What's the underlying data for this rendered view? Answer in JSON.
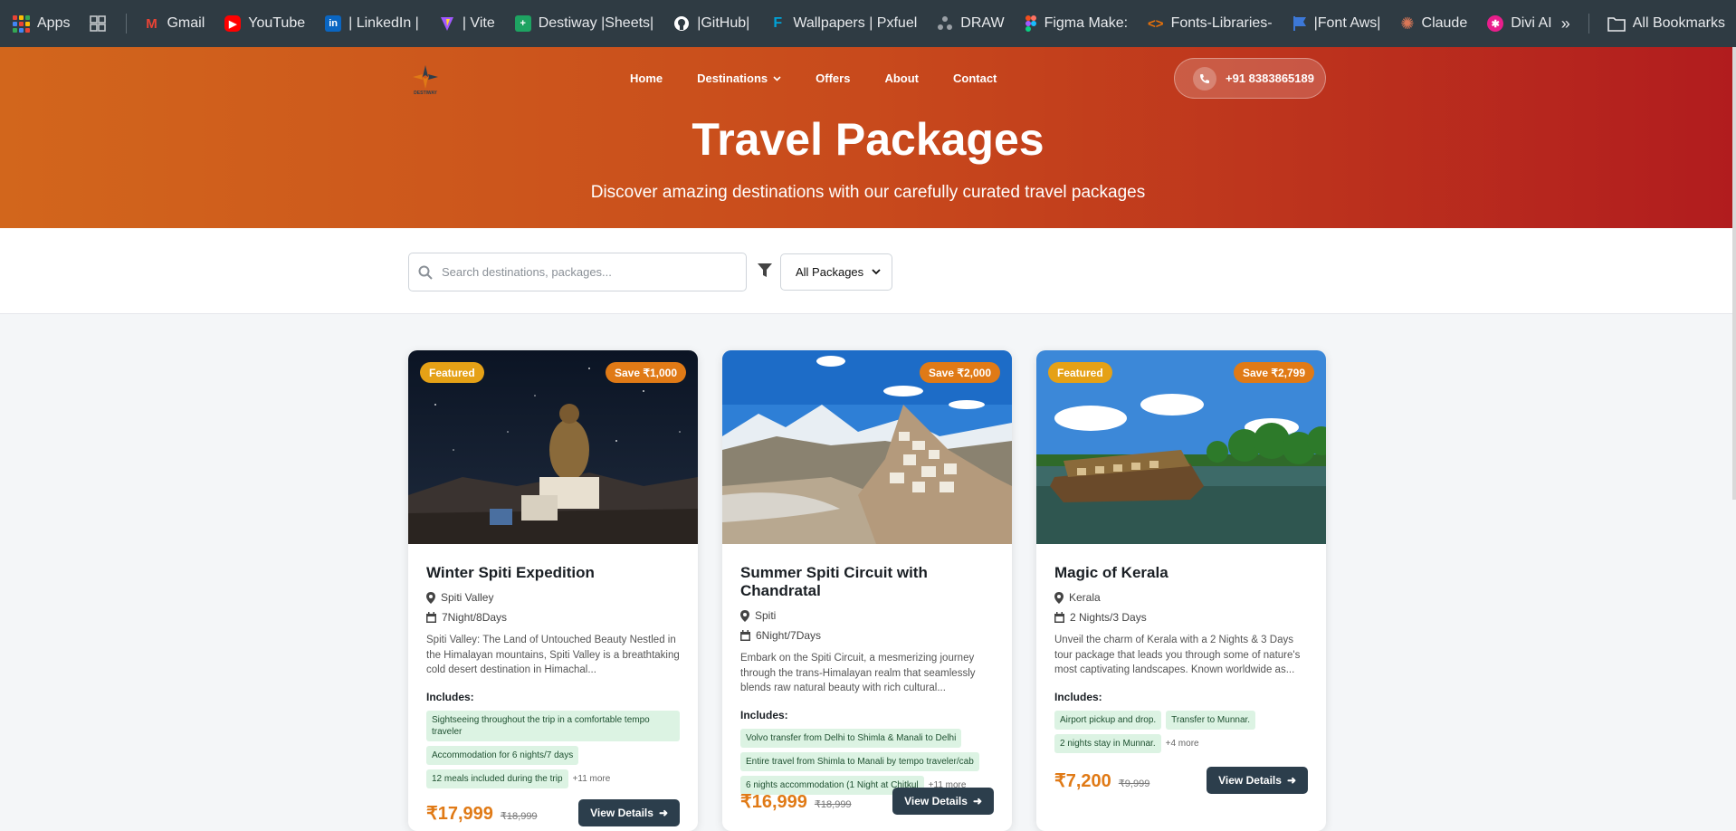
{
  "bookmarks": {
    "apps_label": "Apps",
    "items": [
      {
        "label": "Gmail",
        "icon": "gmail-icon",
        "color": "#ea4335"
      },
      {
        "label": "YouTube",
        "icon": "youtube-icon",
        "color": "#ff0000"
      },
      {
        "label": "| LinkedIn |",
        "icon": "linkedin-icon",
        "color": "#0a66c2"
      },
      {
        "label": "| Vite",
        "icon": "vite-icon",
        "color": "#a259ff"
      },
      {
        "label": "Destiway |Sheets|",
        "icon": "sheets-icon",
        "color": "#1ea362"
      },
      {
        "label": "|GitHub|",
        "icon": "github-icon",
        "color": "#ffffff"
      },
      {
        "label": "Wallpapers | Pxfuel",
        "icon": "pxfuel-icon",
        "color": "#00a2d8"
      },
      {
        "label": "DRAW",
        "icon": "draw-icon",
        "color": "#9aa0a6"
      },
      {
        "label": "Figma Make:",
        "icon": "figma-icon",
        "color": "#f24e1e"
      },
      {
        "label": "Fonts-Libraries-",
        "icon": "code-icon",
        "color": "#e8710a"
      },
      {
        "label": "|Font Aws|",
        "icon": "flag-icon",
        "color": "#3c78d8"
      },
      {
        "label": "Claude",
        "icon": "claude-icon",
        "color": "#d97757"
      },
      {
        "label": "Divi AI",
        "icon": "divi-icon",
        "color": "#e91e8c"
      }
    ],
    "all_bookmarks_label": "All Bookmarks"
  },
  "header": {
    "logo_alt": "DESTIWAY",
    "nav": {
      "home": "Home",
      "destinations": "Destinations",
      "offers": "Offers",
      "about": "About",
      "contact": "Contact"
    },
    "phone": "+91 8383865189",
    "colors": {
      "gradient_start": "#d2661c",
      "gradient_end": "#b11c1e"
    }
  },
  "hero": {
    "title": "Travel Packages",
    "subtitle": "Discover amazing destinations with our carefully curated travel packages"
  },
  "search": {
    "placeholder": "Search destinations, packages...",
    "filter_value": "All Packages"
  },
  "packages": [
    {
      "featured": "Featured",
      "save": "Save ₹1,000",
      "title": "Winter Spiti Expedition",
      "location": "Spiti Valley",
      "duration": "7Night/8Days",
      "description": "Spiti Valley: The Land of Untouched Beauty Nestled in the Himalayan mountains, Spiti Valley is a breathtaking cold desert destination in Himachal...",
      "includes_label": "Includes:",
      "includes": [
        "Sightseeing throughout the trip in a comfortable tempo traveler",
        "Accommodation for 6 nights/7 days",
        "12 meals included during the trip"
      ],
      "more": "+11 more",
      "price": "₹17,999",
      "old_price": "₹18,999",
      "cta": "View Details"
    },
    {
      "featured": "",
      "save": "Save ₹2,000",
      "title": "Summer Spiti Circuit with Chandratal",
      "location": "Spiti",
      "duration": "6Night/7Days",
      "description": "Embark on the Spiti Circuit, a mesmerizing journey through the trans-Himalayan realm that seamlessly blends raw natural beauty with rich cultural...",
      "includes_label": "Includes:",
      "includes": [
        "Volvo transfer from Delhi to Shimla & Manali to Delhi",
        "Entire travel from Shimla to Manali by tempo traveler/cab",
        "6 nights accommodation (1 Night at Chitkul"
      ],
      "more": "+11 more",
      "price": "₹16,999",
      "old_price": "₹18,999",
      "cta": "View Details"
    },
    {
      "featured": "Featured",
      "save": "Save ₹2,799",
      "title": "Magic of Kerala",
      "location": "Kerala",
      "duration": "2 Nights/3 Days",
      "description": "Unveil the charm of Kerala with a 2 Nights & 3 Days tour package that leads you through some of nature's most captivating landscapes. Known worldwide as...",
      "includes_label": "Includes:",
      "includes": [
        "Airport pickup and drop.",
        "Transfer to Munnar.",
        "2 nights stay in Munnar."
      ],
      "more": "+4 more",
      "price": "₹7,200",
      "old_price": "₹9,999",
      "cta": "View Details"
    }
  ]
}
